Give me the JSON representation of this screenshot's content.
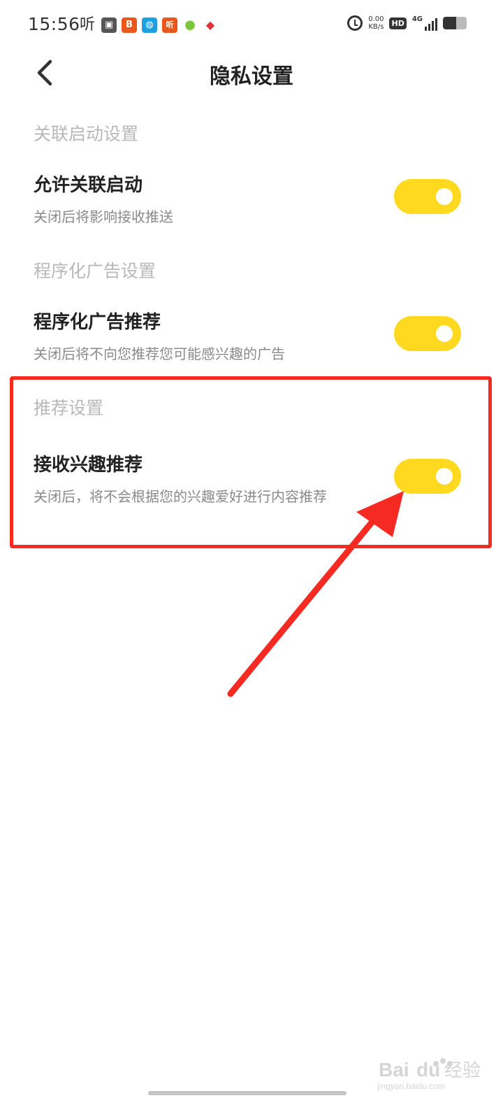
{
  "status_bar": {
    "time": "15:56",
    "ting_label": "听",
    "app_icons": [
      {
        "name": "sb-app-icon-1",
        "glyph": "▣",
        "color": "#555555"
      },
      {
        "name": "sb-app-icon-2",
        "glyph": "B",
        "color": "#e8581d"
      },
      {
        "name": "sb-app-icon-3",
        "glyph": "◍",
        "color": "#1d9fe0"
      },
      {
        "name": "sb-app-icon-4",
        "glyph": "听",
        "color": "#e8581d"
      },
      {
        "name": "sb-app-icon-5",
        "glyph": "●",
        "color": "#7cc63b"
      },
      {
        "name": "sb-app-icon-6",
        "glyph": "◆",
        "color": "#e0343a"
      }
    ],
    "net_speed_value": "0.00",
    "net_speed_unit": "KB/s",
    "hd_label": "HD",
    "network_label": "4G",
    "battery_level": 0.55
  },
  "header": {
    "title": "隐私设置"
  },
  "sections": [
    {
      "title": "关联启动设置",
      "item": {
        "title": "允许关联启动",
        "desc": "关闭后将影响接收推送",
        "enabled": true
      }
    },
    {
      "title": "程序化广告设置",
      "item": {
        "title": "程序化广告推荐",
        "desc": "关闭后将不向您推荐您可能感兴趣的广告",
        "enabled": true
      }
    },
    {
      "title": "推荐设置",
      "item": {
        "title": "接收兴趣推荐",
        "desc": "关闭后，将不会根据您的兴趣爱好进行内容推荐",
        "enabled": true
      }
    }
  ],
  "colors": {
    "toggle_on": "#ffd91f",
    "annotation": "#f52a22"
  },
  "watermark": {
    "brand": "Baidu经验",
    "domain": "jingyan.baidu.com"
  }
}
